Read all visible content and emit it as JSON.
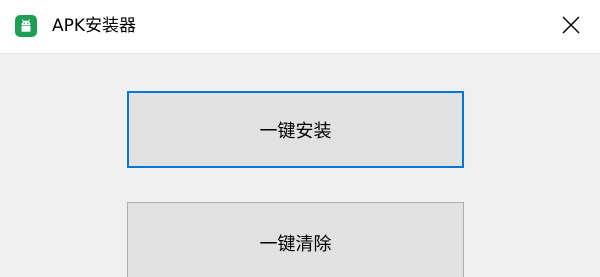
{
  "window": {
    "title": "APK安装器",
    "icon": "android-icon",
    "close_icon": "close-icon"
  },
  "buttons": {
    "install_label": "一键安装",
    "clear_label": "一键清除"
  },
  "colors": {
    "icon_bg": "#1e9d57",
    "focus_border": "#0078d7",
    "button_bg": "#e1e1e1"
  }
}
